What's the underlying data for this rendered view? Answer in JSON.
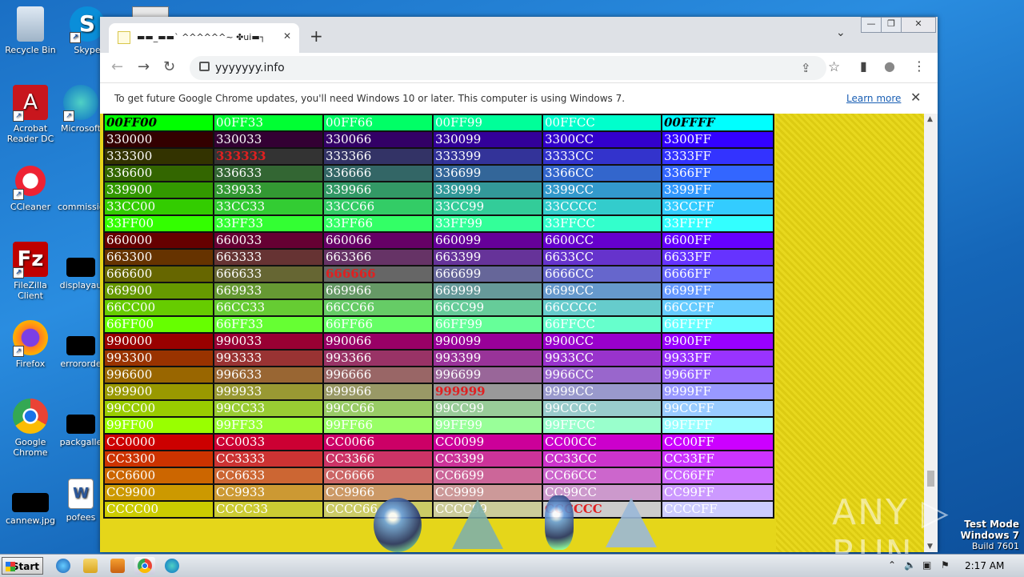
{
  "desktop": {
    "icons": [
      {
        "label": "Recycle Bin"
      },
      {
        "label": "Skype"
      },
      {
        "label": "Acrobat Reader DC"
      },
      {
        "label": "Microsoft"
      },
      {
        "label": "CCleaner"
      },
      {
        "label": "commissio"
      },
      {
        "label": "FileZilla Client"
      },
      {
        "label": "displayau"
      },
      {
        "label": "Firefox"
      },
      {
        "label": "errororde"
      },
      {
        "label": "Google Chrome"
      },
      {
        "label": "packgalle"
      },
      {
        "label": "cannew.jpg"
      },
      {
        "label": "pofees"
      }
    ]
  },
  "browser": {
    "tab_title": "▬▬_▬▬` ^^^^^^~ ✤ui▬┐",
    "tab_close": "✕",
    "new_tab": "+",
    "tab_menu": "⌄",
    "window_controls": {
      "minimize": "—",
      "restore": "❐",
      "close": "✕"
    },
    "nav": {
      "back": "←",
      "forward": "→",
      "reload": "↻"
    },
    "url": "yyyyyyy.info",
    "toolbar_icons": {
      "share": "⇪",
      "bookmark": "☆",
      "sidepanel": "▮",
      "profile": "●",
      "menu": "⋮"
    },
    "infobar": {
      "message": "To get future Google Chrome updates, you'll need Windows 10 or later. This computer is using Windows 7.",
      "learn_more": "Learn more",
      "close": "✕"
    }
  },
  "color_table": {
    "rows": [
      [
        "00FF00",
        "00FF33",
        "00FF66",
        "00FF99",
        "00FFCC",
        "00FFFF"
      ],
      [
        "330000",
        "330033",
        "330066",
        "330099",
        "3300CC",
        "3300FF"
      ],
      [
        "333300",
        "333333",
        "333366",
        "333399",
        "3333CC",
        "3333FF"
      ],
      [
        "336600",
        "336633",
        "336666",
        "336699",
        "3366CC",
        "3366FF"
      ],
      [
        "339900",
        "339933",
        "339966",
        "339999",
        "3399CC",
        "3399FF"
      ],
      [
        "33CC00",
        "33CC33",
        "33CC66",
        "33CC99",
        "33CCCC",
        "33CCFF"
      ],
      [
        "33FF00",
        "33FF33",
        "33FF66",
        "33FF99",
        "33FFCC",
        "33FFFF"
      ],
      [
        "660000",
        "660033",
        "660066",
        "660099",
        "6600CC",
        "6600FF"
      ],
      [
        "663300",
        "663333",
        "663366",
        "663399",
        "6633CC",
        "6633FF"
      ],
      [
        "666600",
        "666633",
        "666666",
        "666699",
        "6666CC",
        "6666FF"
      ],
      [
        "669900",
        "669933",
        "669966",
        "669999",
        "6699CC",
        "6699FF"
      ],
      [
        "66CC00",
        "66CC33",
        "66CC66",
        "66CC99",
        "66CCCC",
        "66CCFF"
      ],
      [
        "66FF00",
        "66FF33",
        "66FF66",
        "66FF99",
        "66FFCC",
        "66FFFF"
      ],
      [
        "990000",
        "990033",
        "990066",
        "990099",
        "9900CC",
        "9900FF"
      ],
      [
        "993300",
        "993333",
        "993366",
        "993399",
        "9933CC",
        "9933FF"
      ],
      [
        "996600",
        "996633",
        "996666",
        "996699",
        "9966CC",
        "9966FF"
      ],
      [
        "999900",
        "999933",
        "999966",
        "999999",
        "9999CC",
        "9999FF"
      ],
      [
        "99CC00",
        "99CC33",
        "99CC66",
        "99CC99",
        "99CCCC",
        "99CCFF"
      ],
      [
        "99FF00",
        "99FF33",
        "99FF66",
        "99FF99",
        "99FFCC",
        "99FFFF"
      ],
      [
        "CC0000",
        "CC0033",
        "CC0066",
        "CC0099",
        "CC00CC",
        "CC00FF"
      ],
      [
        "CC3300",
        "CC3333",
        "CC3366",
        "CC3399",
        "CC33CC",
        "CC33FF"
      ],
      [
        "CC6600",
        "CC6633",
        "CC6666",
        "CC6699",
        "CC66CC",
        "CC66FF"
      ],
      [
        "CC9900",
        "CC9933",
        "CC9966",
        "CC9999",
        "CC99CC",
        "CC99FF"
      ],
      [
        "CCCC00",
        "CCCC33",
        "CCCC66",
        "CCCC99",
        "CCCCCC",
        "CCCCFF"
      ]
    ],
    "highlighted": [
      "00FF00",
      "00FFFF",
      "333333",
      "666666",
      "999999",
      "CCCCCC"
    ]
  },
  "watermark": "ANY ▷ RUN",
  "test_mode": {
    "line1": "Test Mode",
    "line2": "Windows 7",
    "line3": "Build 7601"
  },
  "taskbar": {
    "start_label": "Start",
    "clock": "2:17 AM"
  }
}
